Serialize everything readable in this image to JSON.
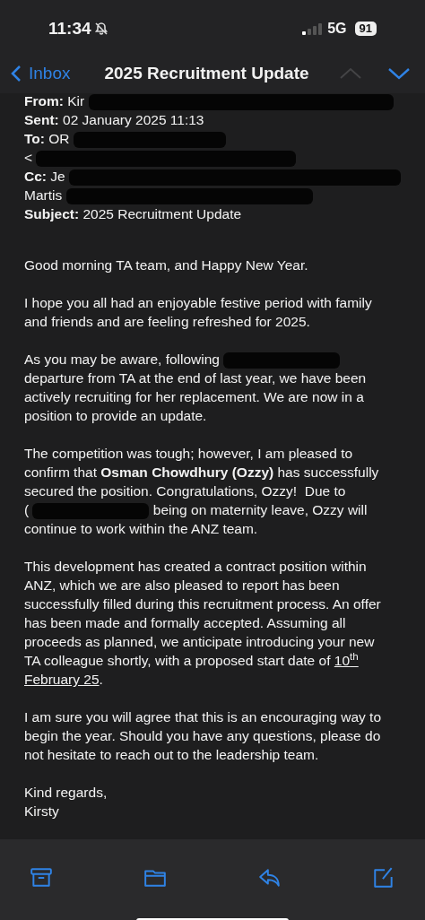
{
  "status_bar": {
    "time": "11:34",
    "network": "5G",
    "battery": "91"
  },
  "nav": {
    "back": "Inbox",
    "title": "2025 Recruitment Update",
    "previous_disabled": true,
    "next_disabled": false
  },
  "header": [
    {
      "parts": [
        {
          "kind": "label",
          "text": "From:"
        },
        {
          "kind": "text",
          "text": "Kir"
        },
        {
          "kind": "redaction"
        }
      ]
    },
    {
      "parts": [
        {
          "kind": "label",
          "text": "Sent:"
        },
        {
          "kind": "text",
          "text": "02 January 2025 11:13"
        }
      ]
    },
    {
      "parts": [
        {
          "kind": "label",
          "text": "To:"
        },
        {
          "kind": "text",
          "text": "OR"
        },
        {
          "kind": "redaction"
        }
      ]
    },
    {
      "parts": [
        {
          "kind": "text",
          "text": "<"
        },
        {
          "kind": "redaction"
        }
      ]
    },
    {
      "parts": [
        {
          "kind": "label",
          "text": "Cc:"
        },
        {
          "kind": "text",
          "text": "Je"
        },
        {
          "kind": "redaction"
        }
      ]
    },
    {
      "parts": [
        {
          "kind": "text",
          "text": "Martis"
        },
        {
          "kind": "redaction"
        }
      ]
    },
    {
      "parts": [
        {
          "kind": "label",
          "text": "Subject:"
        },
        {
          "kind": "text",
          "text": "2025 Recruitment Update"
        }
      ]
    }
  ],
  "body": [
    {
      "lines": [
        {
          "parts": [
            {
              "kind": "text",
              "text": "Good morning TA team, and Happy New Year."
            }
          ]
        }
      ]
    },
    {
      "lines": [
        {
          "parts": [
            {
              "kind": "text",
              "text": "I hope you all had an enjoyable festive period with family"
            }
          ]
        },
        {
          "parts": [
            {
              "kind": "text",
              "text": "and friends and are feeling refreshed for 2025."
            }
          ]
        }
      ]
    },
    {
      "lines": [
        {
          "parts": [
            {
              "kind": "text",
              "text": "As you may be aware, following"
            },
            {
              "kind": "redaction"
            }
          ]
        },
        {
          "parts": [
            {
              "kind": "text",
              "text": "departure from TA at the end of last year, we have been"
            }
          ]
        },
        {
          "parts": [
            {
              "kind": "text",
              "text": "actively recruiting for her replacement. We are now in a"
            }
          ]
        },
        {
          "parts": [
            {
              "kind": "text",
              "text": "position to provide an update."
            }
          ]
        }
      ]
    },
    {
      "lines": [
        {
          "parts": [
            {
              "kind": "text",
              "text": "The competition was tough; however, I am pleased to"
            }
          ]
        },
        {
          "parts": [
            {
              "kind": "text",
              "text": "confirm that **Osman Chowdhury (Ozzy)** has successfully"
            }
          ]
        },
        {
          "parts": [
            {
              "kind": "text",
              "text": "secured the position. Congratulations, Ozzy!  Due to"
            }
          ]
        },
        {
          "parts": [
            {
              "kind": "text",
              "text": "("
            },
            {
              "kind": "redaction"
            },
            {
              "kind": "text",
              "text": "being on maternity leave, Ozzy will"
            }
          ]
        },
        {
          "parts": [
            {
              "kind": "text",
              "text": "continue to work within the ANZ team."
            }
          ]
        }
      ]
    },
    {
      "lines": [
        {
          "parts": [
            {
              "kind": "text",
              "text": "This development has created a contract position within"
            }
          ]
        },
        {
          "parts": [
            {
              "kind": "text",
              "text": "ANZ, which we are also pleased to report has been"
            }
          ]
        },
        {
          "parts": [
            {
              "kind": "text",
              "text": "successfully filled during this recruitment process. An offer"
            }
          ]
        },
        {
          "parts": [
            {
              "kind": "text",
              "text": "has been made and formally accepted. Assuming all"
            }
          ]
        },
        {
          "parts": [
            {
              "kind": "text",
              "text": "proceeds as planned, we anticipate introducing your new"
            }
          ]
        },
        {
          "parts": [
            {
              "kind": "text",
              "text": "TA colleague shortly, with a proposed start date of"
            },
            {
              "kind": "link",
              "text": "10$^{th}$"
            }
          ]
        },
        {
          "parts": [
            {
              "kind": "link",
              "text": "February 25"
            },
            {
              "kind": "text",
              "text": "."
            }
          ]
        }
      ]
    },
    {
      "lines": [
        {
          "parts": [
            {
              "kind": "text",
              "text": "I am sure you will agree that this is an encouraging way to"
            }
          ]
        },
        {
          "parts": [
            {
              "kind": "text",
              "text": "begin the year. Should you have any questions, please do"
            }
          ]
        },
        {
          "parts": [
            {
              "kind": "text",
              "text": "not hesitate to reach out to the leadership team."
            }
          ]
        }
      ]
    },
    {
      "lines": [
        {
          "parts": [
            {
              "kind": "text",
              "text": "Kind regards,"
            }
          ]
        },
        {
          "parts": [
            {
              "kind": "text",
              "text": "Kirsty"
            }
          ]
        }
      ]
    }
  ],
  "toolbar": [
    {
      "kind": "archive"
    },
    {
      "kind": "folder"
    },
    {
      "kind": "reply"
    },
    {
      "kind": "compose"
    }
  ]
}
